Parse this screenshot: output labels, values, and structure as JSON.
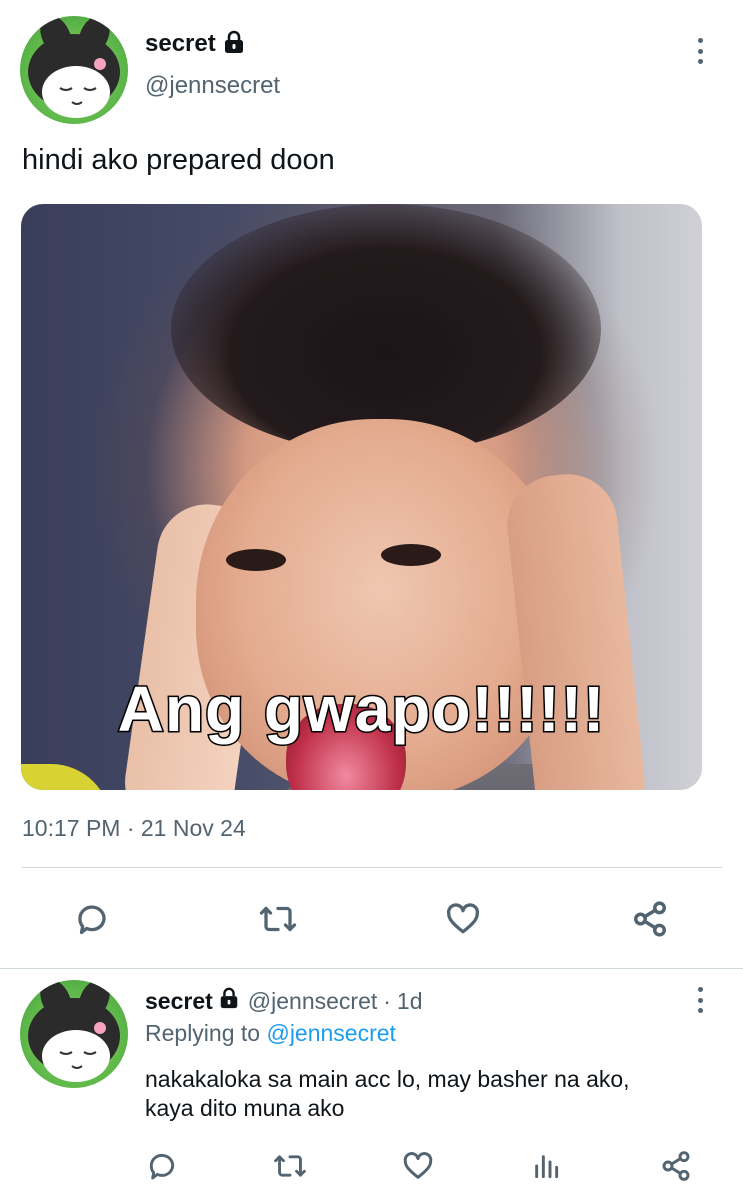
{
  "main_tweet": {
    "author_name": "secret",
    "author_handle": "@jennsecret",
    "text": "hindi ako prepared doon",
    "media_caption": "Ang gwapo!!!!!!",
    "timestamp": "10:17 PM · 21 Nov 24",
    "actions": [
      "reply-icon",
      "retweet-icon",
      "like-icon",
      "share-icon"
    ]
  },
  "reply_tweet": {
    "author_name": "secret",
    "author_handle": "@jennsecret",
    "separator": "·",
    "age": "1d",
    "replying_prefix": "Replying to",
    "replying_handle": "@jennsecret",
    "text_line1": "nakakaloka sa main acc lo, may basher na ako,",
    "text_line2": "kaya dito muna ako",
    "actions": [
      "reply-icon",
      "retweet-icon",
      "like-icon",
      "views-icon",
      "share-icon"
    ]
  },
  "colors": {
    "text": "#0f1419",
    "secondary": "#536471",
    "link": "#1d9bf0",
    "divider": "#cfd9de"
  }
}
